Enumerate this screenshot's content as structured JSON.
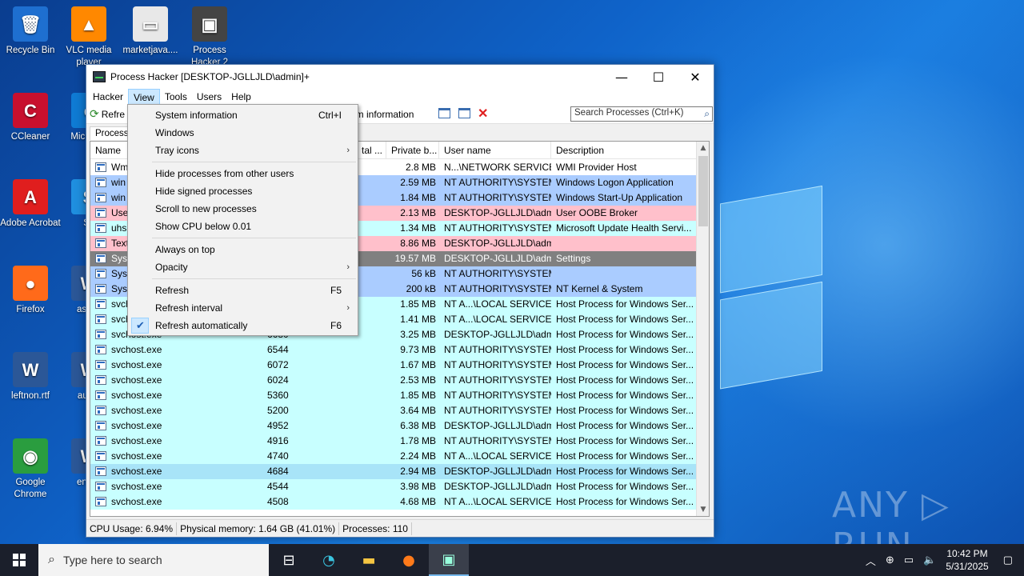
{
  "desktop": {
    "icons": [
      {
        "label": "Recycle Bin",
        "glyph": "🗑",
        "bg": "#1e6fd0"
      },
      {
        "label": "VLC media player",
        "glyph": "▲",
        "bg": "#ff8800"
      },
      {
        "label": "marketjava....",
        "glyph": "▭",
        "bg": "#e8e8e8"
      },
      {
        "label": "Process Hacker 2",
        "glyph": "▣",
        "bg": "#444"
      },
      {
        "label": "CCleaner",
        "glyph": "C",
        "bg": "#c8102e"
      },
      {
        "label": "Micro Ed",
        "glyph": "e",
        "bg": "#0f7bd4"
      },
      {
        "label": "Adobe Acrobat",
        "glyph": "A",
        "bg": "#e01e1e"
      },
      {
        "label": "Sk",
        "glyph": "S",
        "bg": "#1f8fe0"
      },
      {
        "label": "Firefox",
        "glyph": "●",
        "bg": "#ff6a1a"
      },
      {
        "label": "askfin",
        "glyph": "W",
        "bg": "#2b5797"
      },
      {
        "label": "leftnon.rtf",
        "glyph": "W",
        "bg": "#2b5797"
      },
      {
        "label": "autos",
        "glyph": "W",
        "bg": "#2b5797"
      },
      {
        "label": "Google Chrome",
        "glyph": "◉",
        "bg": "#2a9d3f"
      },
      {
        "label": "englis",
        "glyph": "W",
        "bg": "#2b5797"
      }
    ],
    "watermark": "ANY ▷ RUN"
  },
  "window": {
    "title": "Process Hacker [DESKTOP-JGLLJLD\\admin]+",
    "minimize": "—",
    "maximize": "☐",
    "close": "✕"
  },
  "menubar": {
    "items": [
      "Hacker",
      "View",
      "Tools",
      "Users",
      "Help"
    ]
  },
  "toolbar": {
    "refresh_label": "Refre",
    "sysinfo_label": "em information",
    "search_placeholder": "Search Processes (Ctrl+K)"
  },
  "tabs": {
    "processes": "Processe"
  },
  "grid": {
    "columns": [
      "Name",
      "tal ...",
      "Private b...",
      "User name",
      "Description"
    ],
    "rows": [
      {
        "name": "Wm",
        "pid": "",
        "private": "2.8 MB",
        "user": "N...\\NETWORK SERVICE",
        "desc": "WMI Provider Host",
        "bg": "#ffffff"
      },
      {
        "name": "win",
        "pid": "",
        "private": "2.59 MB",
        "user": "NT AUTHORITY\\SYSTEM",
        "desc": "Windows Logon Application",
        "bg": "#aaccff"
      },
      {
        "name": "win",
        "pid": "",
        "private": "1.84 MB",
        "user": "NT AUTHORITY\\SYSTEM",
        "desc": "Windows Start-Up Application",
        "bg": "#aaccff"
      },
      {
        "name": "Use",
        "pid": "",
        "private": "2.13 MB",
        "user": "DESKTOP-JGLLJLD\\admi",
        "desc": "User OOBE Broker",
        "bg": "#ffc0cb"
      },
      {
        "name": "uhs",
        "pid": "",
        "private": "1.34 MB",
        "user": "NT AUTHORITY\\SYSTEM",
        "desc": "Microsoft Update Health Servi...",
        "bg": "#c8ffff"
      },
      {
        "name": "Text",
        "pid": "",
        "private": "8.86 MB",
        "user": "DESKTOP-JGLLJLD\\admi",
        "desc": "",
        "bg": "#ffc0cb"
      },
      {
        "name": "Syst",
        "pid": "",
        "private": "19.57 MB",
        "user": "DESKTOP-JGLLJLD\\admi",
        "desc": "Settings",
        "bg": "#808080"
      },
      {
        "name": "Syst",
        "pid": "",
        "private": "56 kB",
        "user": "NT AUTHORITY\\SYSTEM",
        "desc": "",
        "bg": "#aaccff"
      },
      {
        "name": "Syst",
        "pid": "",
        "private": "200 kB",
        "user": "NT AUTHORITY\\SYSTEM",
        "desc": "NT Kernel & System",
        "bg": "#aaccff"
      },
      {
        "name": "svch",
        "pid": "",
        "private": "1.85 MB",
        "user": "NT A...\\LOCAL SERVICE",
        "desc": "Host Process for Windows Ser...",
        "bg": "#c8ffff"
      },
      {
        "name": "svch",
        "pid": "",
        "private": "1.41 MB",
        "user": "NT A...\\LOCAL SERVICE",
        "desc": "Host Process for Windows Ser...",
        "bg": "#c8ffff"
      },
      {
        "name": "svchost.exe",
        "pid": "6680",
        "private": "3.25 MB",
        "user": "DESKTOP-JGLLJLD\\admi",
        "desc": "Host Process for Windows Ser...",
        "bg": "#c8ffff"
      },
      {
        "name": "svchost.exe",
        "pid": "6544",
        "private": "9.73 MB",
        "user": "NT AUTHORITY\\SYSTEM",
        "desc": "Host Process for Windows Ser...",
        "bg": "#c8ffff"
      },
      {
        "name": "svchost.exe",
        "pid": "6072",
        "private": "1.67 MB",
        "user": "NT AUTHORITY\\SYSTEM",
        "desc": "Host Process for Windows Ser...",
        "bg": "#c8ffff"
      },
      {
        "name": "svchost.exe",
        "pid": "6024",
        "private": "2.53 MB",
        "user": "NT AUTHORITY\\SYSTEM",
        "desc": "Host Process for Windows Ser...",
        "bg": "#c8ffff"
      },
      {
        "name": "svchost.exe",
        "pid": "5360",
        "private": "1.85 MB",
        "user": "NT AUTHORITY\\SYSTEM",
        "desc": "Host Process for Windows Ser...",
        "bg": "#c8ffff"
      },
      {
        "name": "svchost.exe",
        "pid": "5200",
        "private": "3.64 MB",
        "user": "NT AUTHORITY\\SYSTEM",
        "desc": "Host Process for Windows Ser...",
        "bg": "#c8ffff"
      },
      {
        "name": "svchost.exe",
        "pid": "4952",
        "private": "6.38 MB",
        "user": "DESKTOP-JGLLJLD\\admi",
        "desc": "Host Process for Windows Ser...",
        "bg": "#c8ffff"
      },
      {
        "name": "svchost.exe",
        "pid": "4916",
        "private": "1.78 MB",
        "user": "NT AUTHORITY\\SYSTEM",
        "desc": "Host Process for Windows Ser...",
        "bg": "#c8ffff"
      },
      {
        "name": "svchost.exe",
        "pid": "4740",
        "private": "2.24 MB",
        "user": "NT A...\\LOCAL SERVICE",
        "desc": "Host Process for Windows Ser...",
        "bg": "#c8ffff"
      },
      {
        "name": "svchost.exe",
        "pid": "4684",
        "private": "2.94 MB",
        "user": "DESKTOP-JGLLJLD\\admi",
        "desc": "Host Process for Windows Ser...",
        "bg": "#a8e4f8"
      },
      {
        "name": "svchost.exe",
        "pid": "4544",
        "private": "3.98 MB",
        "user": "DESKTOP-JGLLJLD\\admi",
        "desc": "Host Process for Windows Ser...",
        "bg": "#c8ffff"
      },
      {
        "name": "svchost.exe",
        "pid": "4508",
        "private": "4.68 MB",
        "user": "NT A...\\LOCAL SERVICE",
        "desc": "Host Process for Windows Ser...",
        "bg": "#c8ffff"
      }
    ]
  },
  "view_menu": {
    "items": [
      {
        "label": "System information",
        "shortcut": "Ctrl+I",
        "submenu": false,
        "checked": false
      },
      {
        "label": "Windows",
        "shortcut": "",
        "submenu": false,
        "checked": false
      },
      {
        "label": "Tray icons",
        "shortcut": "",
        "submenu": true,
        "checked": false
      },
      {
        "sep": true
      },
      {
        "label": "Hide processes from other users",
        "shortcut": "",
        "submenu": false,
        "checked": false
      },
      {
        "label": "Hide signed processes",
        "shortcut": "",
        "submenu": false,
        "checked": false
      },
      {
        "label": "Scroll to new processes",
        "shortcut": "",
        "submenu": false,
        "checked": false
      },
      {
        "label": "Show CPU below 0.01",
        "shortcut": "",
        "submenu": false,
        "checked": false
      },
      {
        "sep": true
      },
      {
        "label": "Always on top",
        "shortcut": "",
        "submenu": false,
        "checked": false
      },
      {
        "label": "Opacity",
        "shortcut": "",
        "submenu": true,
        "checked": false
      },
      {
        "sep": true
      },
      {
        "label": "Refresh",
        "shortcut": "F5",
        "submenu": false,
        "checked": false
      },
      {
        "label": "Refresh interval",
        "shortcut": "",
        "submenu": true,
        "checked": false
      },
      {
        "label": "Refresh automatically",
        "shortcut": "F6",
        "submenu": false,
        "checked": true
      }
    ]
  },
  "statusbar": {
    "cpu": "CPU Usage: 6.94%",
    "memory": "Physical memory: 1.64 GB (41.01%)",
    "processes": "Processes: 110"
  },
  "taskbar": {
    "search_placeholder": "Type here to search",
    "time": "10:42 PM",
    "date": "5/31/2025"
  }
}
